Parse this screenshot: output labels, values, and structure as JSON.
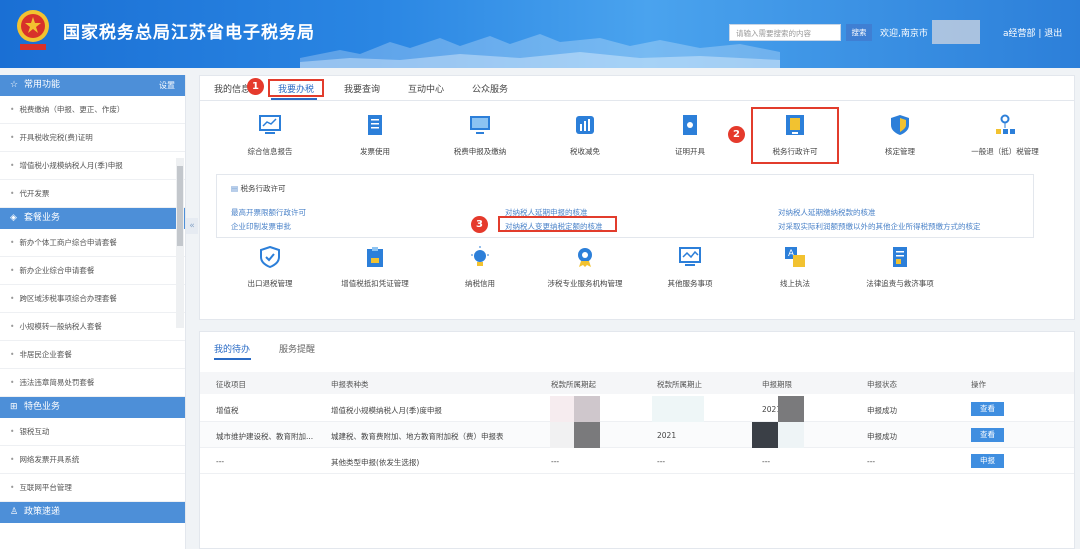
{
  "header": {
    "title": "国家税务总局江苏省电子税务局",
    "search_placeholder": "请输入需要搜索的内容",
    "search_button": "搜索",
    "welcome": "欢迎,南京市",
    "user_links": "a经营部 | 退出"
  },
  "sidebar": {
    "sections": [
      {
        "title": "常用功能",
        "settings": "设置",
        "items": [
          "税费缴纳（申报、更正、作废）",
          "开具税收完税(费)证明",
          "增值税小规模纳税人月(季)申报",
          "代开发票"
        ]
      },
      {
        "title": "套餐业务",
        "items": [
          "新办个体工商户综合申请套餐",
          "新办企业综合申请套餐",
          "跨区域涉税事项综合办理套餐",
          "小规模转一般纳税人套餐",
          "非居民企业套餐",
          "违法违章简易处罚套餐"
        ]
      },
      {
        "title": "特色业务",
        "items": [
          "银税互动",
          "网络发票开具系统",
          "互联网平台管理"
        ]
      },
      {
        "title": "政策速递",
        "items": []
      }
    ],
    "collapse_arrow": "«"
  },
  "main": {
    "tabs": [
      "我的信息",
      "我要办税",
      "我要查询",
      "互动中心",
      "公众服务"
    ],
    "functions_row1": [
      "综合信息报告",
      "发票使用",
      "税费申报及缴纳",
      "税收减免",
      "证明开具",
      "税务行政许可",
      "核定管理",
      "一般退（抵）税管理"
    ],
    "functions_row2": [
      "出口退税管理",
      "增值税抵扣凭证管理",
      "纳税信用",
      "涉税专业服务机构管理",
      "其他服务事项",
      "线上执法",
      "法律追责与救济事项"
    ],
    "submenu": {
      "title": "税务行政许可",
      "links": [
        "最高开票限额行政许可",
        "企业印制发票审批",
        "对纳税人延期申报的核准",
        "对纳税人变更纳税定额的核准",
        "对纳税人延期缴纳税款的核准",
        "对采取实际利润额预缴以外的其他企业所得税预缴方式的核定"
      ]
    },
    "annotations": [
      "1",
      "2",
      "3"
    ]
  },
  "todo": {
    "tabs": [
      "我的待办",
      "服务提醒"
    ],
    "columns": [
      "征收项目",
      "申报表种类",
      "税款所属期起",
      "税款所属期止",
      "申报期限",
      "申报状态",
      "操作"
    ],
    "rows": [
      {
        "item": "增值税",
        "form": "增值税小规模纳税人月(季)度申报",
        "start": "",
        "end": "",
        "deadline": "2021",
        "status": "申报成功",
        "action": "查看"
      },
      {
        "item": "城市维护建设税、教育附加...",
        "form": "城建税、教育费附加、地方教育附加税（费）申报表",
        "start": "",
        "end": "2021",
        "deadline": "",
        "status": "申报成功",
        "action": "查看"
      },
      {
        "item": "---",
        "form": "其他类型申报(依发生选报)",
        "start": "---",
        "end": "---",
        "deadline": "---",
        "status": "---",
        "action": "申报"
      }
    ]
  },
  "colors": {
    "accent": "#2a6bc5",
    "header": "#2a86e3",
    "annotation": "#e53a2c",
    "sidebar_head": "#4d8fd8"
  }
}
